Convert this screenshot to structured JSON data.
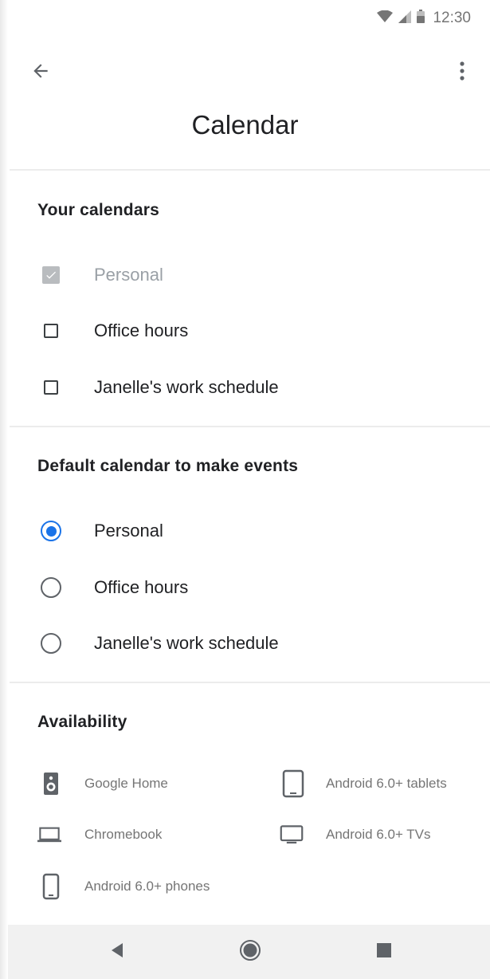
{
  "status_bar": {
    "time": "12:30",
    "icons": [
      "wifi-icon",
      "cell-signal-icon",
      "battery-icon"
    ]
  },
  "app_bar": {
    "title": "Calendar",
    "back_icon": "arrow-back-icon",
    "menu_icon": "more-vert-icon"
  },
  "your_calendars": {
    "title": "Your calendars",
    "items": [
      {
        "label": "Personal",
        "checked": true,
        "disabled": true
      },
      {
        "label": "Office hours",
        "checked": false,
        "disabled": false
      },
      {
        "label": "Janelle's work schedule",
        "checked": false,
        "disabled": false
      }
    ]
  },
  "default_calendar": {
    "title": "Default calendar to make events",
    "items": [
      {
        "label": "Personal",
        "selected": true
      },
      {
        "label": "Office hours",
        "selected": false
      },
      {
        "label": "Janelle's work schedule",
        "selected": false
      }
    ]
  },
  "availability": {
    "title": "Availability",
    "items": [
      {
        "label": "Google Home",
        "icon": "speaker-icon"
      },
      {
        "label": "Android 6.0+ tablets",
        "icon": "tablet-icon"
      },
      {
        "label": "Chromebook",
        "icon": "laptop-icon"
      },
      {
        "label": "Android 6.0+ TVs",
        "icon": "tv-icon"
      },
      {
        "label": "Android 6.0+ phones",
        "icon": "phone-icon"
      }
    ]
  },
  "nav_bar": {
    "buttons": [
      "nav-back-icon",
      "nav-home-icon",
      "nav-recents-icon"
    ]
  },
  "colors": {
    "accent": "#1a73e8",
    "text_primary": "#202124",
    "text_secondary": "#757575",
    "disabled": "#9aa0a6",
    "nav_bar_bg": "#f1f1f1"
  }
}
